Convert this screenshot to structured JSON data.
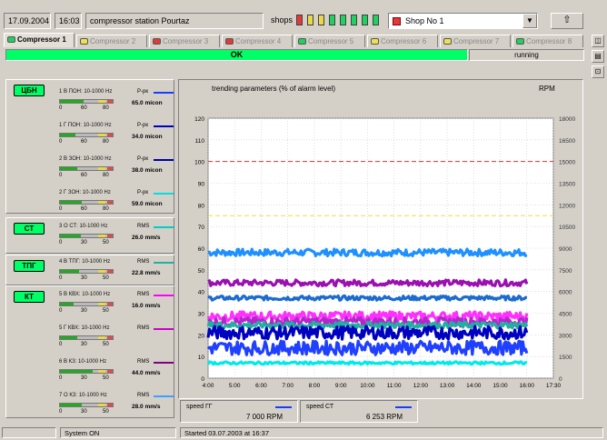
{
  "header": {
    "date": "17.09.2004",
    "time": "16:03",
    "station": "compressor station Pourtaz",
    "shops_label": "shops",
    "shop_selected": "Shop No 1",
    "shop_lamps": [
      "#e23a3a",
      "#e8d84a",
      "#e8d84a",
      "#20d060",
      "#20d060",
      "#20d060",
      "#20d060",
      "#20d060"
    ]
  },
  "tabs": [
    {
      "label": "Compressor 1",
      "lamp": "#20d060",
      "active": true
    },
    {
      "label": "Compressor 2",
      "lamp": "#f0e050",
      "active": false
    },
    {
      "label": "Compressor 3",
      "lamp": "#e23a3a",
      "active": false
    },
    {
      "label": "Compressor 4",
      "lamp": "#e23a3a",
      "active": false
    },
    {
      "label": "Compressor 5",
      "lamp": "#20d060",
      "active": false
    },
    {
      "label": "Compressor 6",
      "lamp": "#f0e050",
      "active": false
    },
    {
      "label": "Compressor 7",
      "lamp": "#f0e050",
      "active": false
    },
    {
      "label": "Compressor 8",
      "lamp": "#20d060",
      "active": false
    }
  ],
  "status": {
    "ok": "OK",
    "state": "running"
  },
  "groups": [
    {
      "label": "ЦБН",
      "sensors": [
        {
          "label": "1 В ПОН: 10-1000 Hz",
          "unit": "Р-рк",
          "value": "65.0 micon",
          "color": "#1a3cff",
          "ticks": [
            "0",
            "60",
            "80"
          ],
          "fill": 0.45
        },
        {
          "label": "1 Г ПОН: 10-1000 Hz",
          "unit": "Р-рк",
          "value": "34.0 micon",
          "color": "#0000c0",
          "ticks": [
            "0",
            "60",
            "80"
          ],
          "fill": 0.3
        },
        {
          "label": "2 В ЗОН: 10-1000 Hz",
          "unit": "Р-рк",
          "value": "38.0 micon",
          "color": "#0000a0",
          "ticks": [
            "0",
            "60",
            "80"
          ],
          "fill": 0.32
        },
        {
          "label": "2 Г ЗОН: 10-1000 Hz",
          "unit": "Р-рк",
          "value": "59.0 micon",
          "color": "#00e0e0",
          "ticks": [
            "0",
            "60",
            "80"
          ],
          "fill": 0.42
        }
      ]
    },
    {
      "label": "СТ",
      "sensors": [
        {
          "label": "3 О СТ: 10-1000 Hz",
          "unit": "RMS",
          "value": "26.0 mm/s",
          "color": "#00cccc",
          "ticks": [
            "0",
            "30",
            "50"
          ],
          "fill": 0.4
        }
      ]
    },
    {
      "label": "ТПГ",
      "sensors": [
        {
          "label": "4 В ТПГ: 10-1000 Hz",
          "unit": "RMS",
          "value": "22.8 mm/s",
          "color": "#20b0a0",
          "ticks": [
            "0",
            "30",
            "50"
          ],
          "fill": 0.36
        }
      ]
    },
    {
      "label": "КТ",
      "sensors": [
        {
          "label": "5 В КВХ: 10-1000 Hz",
          "unit": "RMS",
          "value": "16.0 mm/s",
          "color": "#ff00ff",
          "ticks": [
            "0",
            "30",
            "50"
          ],
          "fill": 0.26
        },
        {
          "label": "5 Г КВХ: 10-1000 Hz",
          "unit": "RMS",
          "value": "",
          "color": "#cc00cc",
          "ticks": [
            "0",
            "30",
            "50"
          ],
          "fill": 0.32
        },
        {
          "label": "6 В КЗ: 10-1000 Hz",
          "unit": "RMS",
          "value": "44.0 mm/s",
          "color": "#800080",
          "ticks": [
            "0",
            "30",
            "50"
          ],
          "fill": 0.62
        },
        {
          "label": "7 О КЗ: 10-1000 Hz",
          "unit": "RMS",
          "value": "28.0 mm/s",
          "color": "#3aa0ff",
          "ticks": [
            "0",
            "30",
            "50"
          ],
          "fill": 0.42
        }
      ]
    }
  ],
  "chart_data": {
    "type": "line",
    "title": "trending parameters (% of alarm level)",
    "y2label": "RPM",
    "x": [
      "4:00",
      "5:00",
      "6:00",
      "7:00",
      "8:00",
      "9:00",
      "10:00",
      "11:00",
      "12:00",
      "13:00",
      "14:00",
      "15:00",
      "16:00",
      "17:30"
    ],
    "ylim": [
      0,
      120
    ],
    "yticks": [
      0,
      10,
      20,
      30,
      40,
      50,
      60,
      70,
      80,
      90,
      100,
      110,
      120
    ],
    "y2ticks": [
      "0",
      "1500",
      "3000",
      "4500",
      "6000",
      "7500",
      "9000",
      "10500",
      "12000",
      "13500",
      "15000",
      "16500",
      "18000"
    ],
    "thresholds": [
      {
        "value": 100,
        "color": "#e03030"
      },
      {
        "value": 75,
        "color": "#e8e040"
      }
    ],
    "grid": true,
    "series": [
      {
        "color": "#1e90ff",
        "level": 58,
        "noise": 1.6
      },
      {
        "color": "#9a10b0",
        "level": 44,
        "noise": 1.4
      },
      {
        "color": "#1c6cd0",
        "level": 37,
        "noise": 1.0
      },
      {
        "color": "#ff30ff",
        "level": 28.5,
        "noise": 2.2
      },
      {
        "color": "#b028c8",
        "level": 26,
        "noise": 2.0
      },
      {
        "color": "#20b0a0",
        "level": 24.5,
        "noise": 1.4
      },
      {
        "color": "#0000c0",
        "level": 21,
        "noise": 3.0
      },
      {
        "color": "#2040ff",
        "level": 14,
        "noise": 3.2
      },
      {
        "color": "#00eaea",
        "level": 7,
        "noise": 0.6
      }
    ]
  },
  "speeds": [
    {
      "name": "speed ГГ",
      "value": "7 000 RPM"
    },
    {
      "name": "speed СТ",
      "value": "6 253 RPM"
    }
  ],
  "statusbar": {
    "system": "System ON",
    "started": "Started 03.07.2003 at 16:37"
  }
}
